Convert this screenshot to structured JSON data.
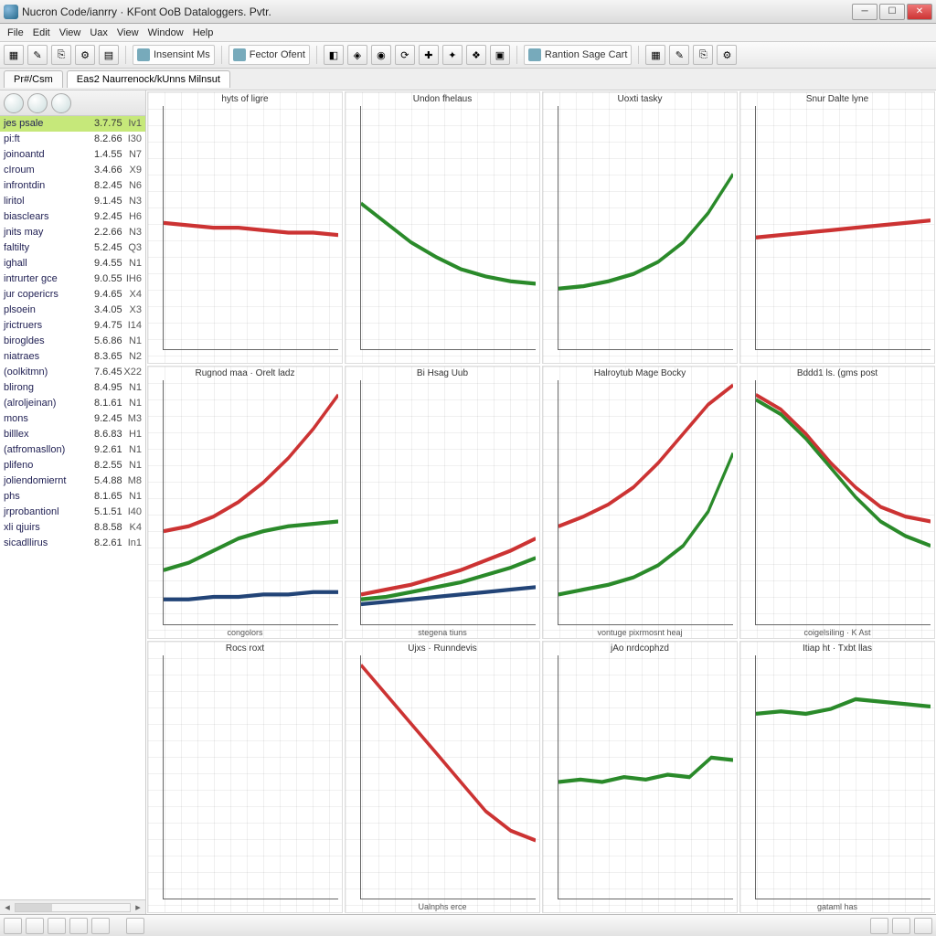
{
  "window": {
    "title": "Nucron Code/ianrry · KFont OoB Dataloggers. Pvtr."
  },
  "menubar": [
    "File",
    "Edit",
    "View",
    "Uax",
    "View",
    "Window",
    "Help"
  ],
  "toolbar": {
    "groups": [
      {
        "type": "icons",
        "count": 5
      },
      {
        "type": "label",
        "icon": true,
        "text": "Insensint Ms"
      },
      {
        "type": "label",
        "icon": true,
        "text": "Fector Ofent"
      },
      {
        "type": "icons",
        "count": 8
      },
      {
        "type": "label",
        "icon": true,
        "text": "Rantion Sage Cart"
      },
      {
        "type": "icons",
        "count": 4
      }
    ]
  },
  "tabs": [
    {
      "label": "Pr#/Csm",
      "active": false
    },
    {
      "label": "Eas2 Naurrenock/kUnns Milnsut",
      "active": true
    }
  ],
  "sidebar": {
    "items": [
      {
        "name": "jes psale",
        "v1": "3.7.75",
        "v2": "Iv1",
        "selected": true
      },
      {
        "name": "pi:ft",
        "v1": "8.2.66",
        "v2": "I30"
      },
      {
        "name": "joinoantd",
        "v1": "1.4.55",
        "v2": "N7"
      },
      {
        "name": "cIroum",
        "v1": "3.4.66",
        "v2": "X9"
      },
      {
        "name": "infrontdin",
        "v1": "8.2.45",
        "v2": "N6"
      },
      {
        "name": "liritol",
        "v1": "9.1.45",
        "v2": "N3"
      },
      {
        "name": "biasclears",
        "v1": "9.2.45",
        "v2": "H6"
      },
      {
        "name": "jnits may",
        "v1": "2.2.66",
        "v2": "N3"
      },
      {
        "name": "faltilty",
        "v1": "5.2.45",
        "v2": "Q3"
      },
      {
        "name": "ighall",
        "v1": "9.4.55",
        "v2": "N1"
      },
      {
        "name": "intrurter gce",
        "v1": "9.0.55",
        "v2": "IH6"
      },
      {
        "name": "jur copericrs",
        "v1": "9.4.65",
        "v2": "X4"
      },
      {
        "name": "plsoein",
        "v1": "3.4.05",
        "v2": "X3"
      },
      {
        "name": "jrictruers",
        "v1": "9.4.75",
        "v2": "I14"
      },
      {
        "name": "birogldes",
        "v1": "5.6.86",
        "v2": "N1"
      },
      {
        "name": "niatraes",
        "v1": "8.3.65",
        "v2": "N2"
      },
      {
        "name": "(oolkitmn)",
        "v1": "7.6.45",
        "v2": "X22"
      },
      {
        "name": "blirong",
        "v1": "8.4.95",
        "v2": "N1"
      },
      {
        "name": "(alroljeinan)",
        "v1": "8.1.61",
        "v2": "N1"
      },
      {
        "name": "mons",
        "v1": "9.2.45",
        "v2": "M3"
      },
      {
        "name": "billlex",
        "v1": "8.6.83",
        "v2": "H1"
      },
      {
        "name": "(atfromasllon)",
        "v1": "9.2.61",
        "v2": "N1"
      },
      {
        "name": "plifeno",
        "v1": "8.2.55",
        "v2": "N1"
      },
      {
        "name": "joliendomiernt",
        "v1": "5.4.88",
        "v2": "M8"
      },
      {
        "name": "phs",
        "v1": "8.1.65",
        "v2": "N1"
      },
      {
        "name": "jrprobantionl",
        "v1": "5.1.51",
        "v2": "I40"
      },
      {
        "name": "xli qjuirs",
        "v1": "8.8.58",
        "v2": "K4"
      },
      {
        "name": "sicadllirus",
        "v1": "8.2.61",
        "v2": "In1"
      }
    ]
  },
  "chart_data": [
    {
      "type": "line",
      "title": "hyts of ligre",
      "xlabel": "",
      "series": [
        {
          "name": "red",
          "values": [
            52,
            51,
            50,
            50,
            49,
            48,
            48,
            47
          ]
        }
      ]
    },
    {
      "type": "line",
      "title": "Undon fhelaus",
      "xlabel": "",
      "series": [
        {
          "name": "green",
          "values": [
            60,
            52,
            44,
            38,
            33,
            30,
            28,
            27
          ]
        }
      ]
    },
    {
      "type": "line",
      "title": "Uoxti tasky",
      "xlabel": "",
      "series": [
        {
          "name": "green",
          "values": [
            25,
            26,
            28,
            31,
            36,
            44,
            56,
            72
          ]
        }
      ]
    },
    {
      "type": "line",
      "title": "Snur Dalte lyne",
      "xlabel": "",
      "series": [
        {
          "name": "red",
          "values": [
            46,
            47,
            48,
            49,
            50,
            51,
            52,
            53
          ]
        }
      ]
    },
    {
      "type": "line",
      "title": "Rugnod maa · Orelt ladz",
      "xlabel": "congolors",
      "series": [
        {
          "name": "red",
          "values": [
            38,
            40,
            44,
            50,
            58,
            68,
            80,
            94
          ]
        },
        {
          "name": "green",
          "values": [
            22,
            25,
            30,
            35,
            38,
            40,
            41,
            42
          ]
        },
        {
          "name": "blue",
          "values": [
            10,
            10,
            11,
            11,
            12,
            12,
            13,
            13
          ]
        }
      ]
    },
    {
      "type": "line",
      "title": "Bi Hsag Uub",
      "xlabel": "stegena tiuns",
      "series": [
        {
          "name": "red",
          "values": [
            12,
            14,
            16,
            19,
            22,
            26,
            30,
            35
          ]
        },
        {
          "name": "green",
          "values": [
            10,
            11,
            13,
            15,
            17,
            20,
            23,
            27
          ]
        },
        {
          "name": "blue",
          "values": [
            8,
            9,
            10,
            11,
            12,
            13,
            14,
            15
          ]
        }
      ]
    },
    {
      "type": "line",
      "title": "Halroytub Mage Bocky",
      "xlabel": "vontuge pixrmosnt heaj",
      "series": [
        {
          "name": "red",
          "values": [
            40,
            44,
            49,
            56,
            66,
            78,
            90,
            98
          ]
        },
        {
          "name": "green",
          "values": [
            12,
            14,
            16,
            19,
            24,
            32,
            46,
            70
          ]
        }
      ]
    },
    {
      "type": "line",
      "title": "Bddd1 ls. (gms post",
      "xlabel": "coigelsiling · K Ast",
      "series": [
        {
          "name": "red",
          "values": [
            94,
            88,
            78,
            66,
            56,
            48,
            44,
            42
          ]
        },
        {
          "name": "green",
          "values": [
            92,
            86,
            76,
            64,
            52,
            42,
            36,
            32
          ]
        }
      ]
    },
    {
      "type": "line",
      "title": "Rocs roxt",
      "xlabel": "",
      "series": []
    },
    {
      "type": "line",
      "title": "Ujxs · Runndevis",
      "xlabel": "Ualnphs erce",
      "series": [
        {
          "name": "red",
          "values": [
            96,
            84,
            72,
            60,
            48,
            36,
            28,
            24
          ]
        }
      ]
    },
    {
      "type": "line",
      "title": "jAo nrdcophzd",
      "xlabel": "",
      "series": [
        {
          "name": "green",
          "values": [
            48,
            49,
            48,
            50,
            49,
            51,
            50,
            58,
            57
          ]
        }
      ]
    },
    {
      "type": "line",
      "title": "Itiap ht · Txbt llas",
      "xlabel": "gataml has",
      "series": [
        {
          "name": "green",
          "values": [
            76,
            77,
            76,
            78,
            82,
            81,
            80,
            79
          ]
        }
      ]
    }
  ],
  "colors": {
    "red": "#c33",
    "green": "#2a8a2a",
    "blue": "#245a8a",
    "accent": "#c6e87a"
  }
}
